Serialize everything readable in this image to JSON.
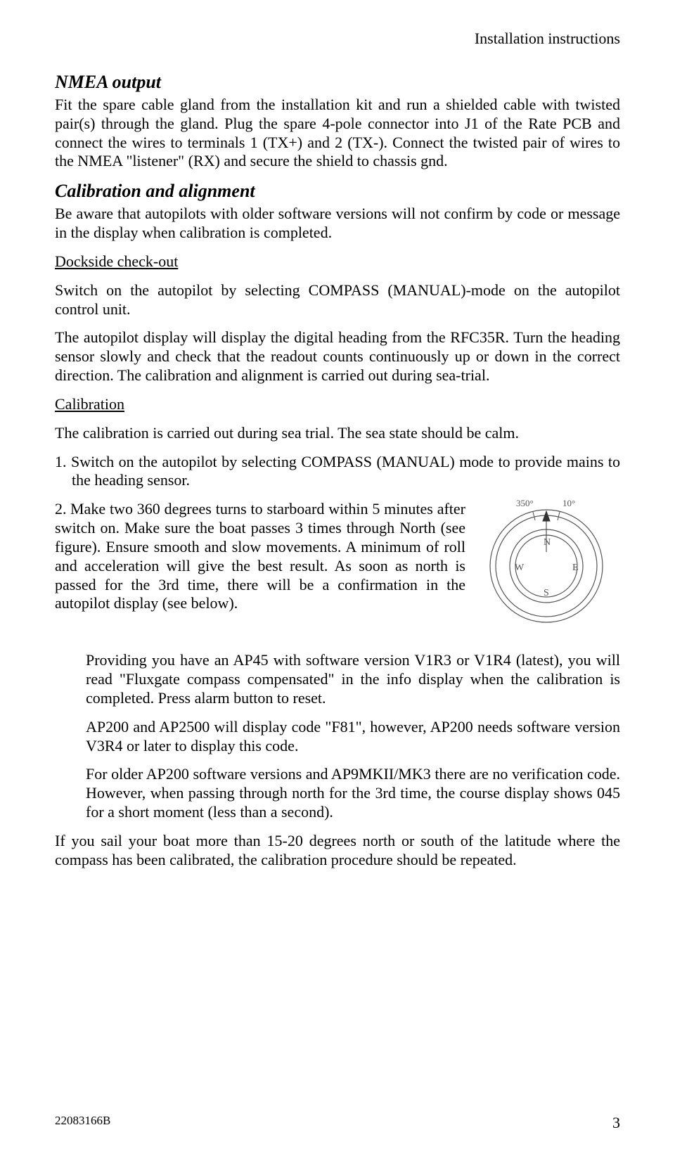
{
  "header": {
    "right": "Installation instructions"
  },
  "nmea": {
    "heading": "NMEA output",
    "p1": "Fit the spare cable gland from the installation kit and run a shielded cable with twisted pair(s) through the gland. Plug the spare 4-pole connector into J1 of the Rate PCB and connect the wires to terminals 1 (TX+) and 2 (TX-). Connect the twisted pair of wires to the NMEA \"listener\" (RX) and secure the shield to chassis gnd."
  },
  "calib": {
    "heading": "Calibration and alignment",
    "p1": "Be aware that autopilots with older software versions will not confirm by code or message in the display when calibration is completed.",
    "dockside_label": "Dockside check-out",
    "p2": "Switch on the autopilot by selecting COMPASS (MANUAL)-mode on the autopilot control unit.",
    "p3": "The autopilot display will display the digital heading from the RFC35R. Turn the heading sensor slowly and check that the readout counts continuously up or down in the correct direction. The calibration and alignment is carried out during sea-trial.",
    "calibration_label": "Calibration",
    "p4": "The calibration is carried out during sea trial. The sea state should be calm.",
    "li1_num": "1.",
    "li1_text": "Switch on the autopilot by selecting COMPASS (MANUAL) mode to provide mains to the heading sensor.",
    "li2_num": "2.",
    "li2_text": "Make two 360 degrees turns to starboard within 5 minutes after switch on. Make sure the boat passes 3 times through North (see figure). Ensure smooth and slow movements. A minimum of roll and acceleration will give the best result. As soon as north is passed for the 3rd time, there will be a confirmation in the autopilot display (see below).",
    "note1": "Providing you have an AP45 with software version V1R3 or V1R4 (latest), you will read \"Fluxgate compass compensated\" in the info display when the calibration is completed. Press alarm button to reset.",
    "note2": "AP200 and AP2500 will display code \"F81\", however, AP200 needs software version V3R4 or later to display this code.",
    "note3": "For older AP200 software versions and AP9MKII/MK3 there are no verification code. However, when passing through north for the 3rd time, the course display shows 045 for a short moment (less than a second).",
    "p5": "If you sail your boat more than 15-20 degrees north or south of the latitude where the compass has been calibrated, the calibration procedure should be repeated."
  },
  "compass": {
    "left_tick": "350°",
    "right_tick": "10°",
    "n": "N",
    "e": "E",
    "s": "S",
    "w": "W"
  },
  "footer": {
    "left": "22083166B",
    "right": "3"
  }
}
